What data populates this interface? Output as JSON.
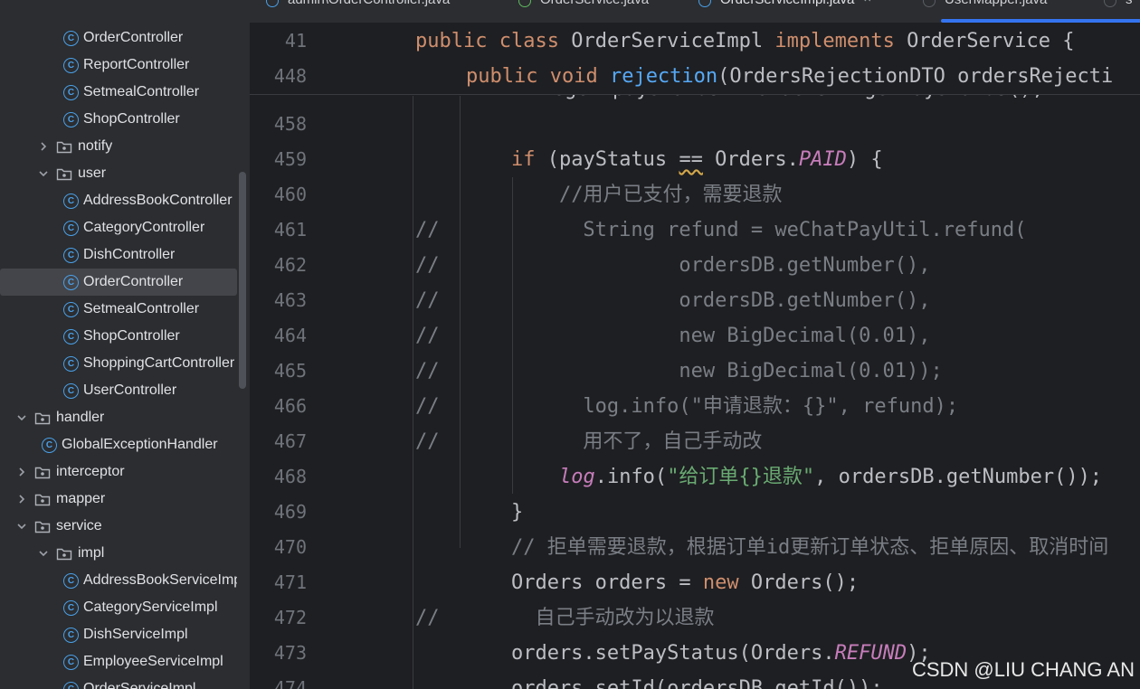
{
  "tree": {
    "items": [
      {
        "label": "OrderController",
        "kind": "class",
        "indent": 2
      },
      {
        "label": "ReportController",
        "kind": "class",
        "indent": 2
      },
      {
        "label": "SetmealController",
        "kind": "class",
        "indent": 2
      },
      {
        "label": "ShopController",
        "kind": "class",
        "indent": 2
      },
      {
        "label": "notify",
        "kind": "folder",
        "indent": 1,
        "expanded": false
      },
      {
        "label": "user",
        "kind": "folder",
        "indent": 1,
        "expanded": true
      },
      {
        "label": "AddressBookController",
        "kind": "class",
        "indent": 2
      },
      {
        "label": "CategoryController",
        "kind": "class",
        "indent": 2
      },
      {
        "label": "DishController",
        "kind": "class",
        "indent": 2
      },
      {
        "label": "OrderController",
        "kind": "class",
        "indent": 2,
        "selected": true
      },
      {
        "label": "SetmealController",
        "kind": "class",
        "indent": 2
      },
      {
        "label": "ShopController",
        "kind": "class",
        "indent": 2
      },
      {
        "label": "ShoppingCartController",
        "kind": "class",
        "indent": 2
      },
      {
        "label": "UserController",
        "kind": "class",
        "indent": 2
      },
      {
        "label": "handler",
        "kind": "folder",
        "indent": 0,
        "expanded": true
      },
      {
        "label": "GlobalExceptionHandler",
        "kind": "class",
        "indent": 1
      },
      {
        "label": "interceptor",
        "kind": "folder",
        "indent": 0,
        "expanded": false
      },
      {
        "label": "mapper",
        "kind": "folder",
        "indent": 0,
        "expanded": false
      },
      {
        "label": "service",
        "kind": "folder",
        "indent": 0,
        "expanded": true
      },
      {
        "label": "impl",
        "kind": "folder",
        "indent": 1,
        "expanded": true
      },
      {
        "label": "AddressBookServiceImpl",
        "kind": "class",
        "indent": 2
      },
      {
        "label": "CategoryServiceImpl",
        "kind": "class",
        "indent": 2
      },
      {
        "label": "DishServiceImpl",
        "kind": "class",
        "indent": 2
      },
      {
        "label": "EmployeeServiceImpl",
        "kind": "class",
        "indent": 2
      },
      {
        "label": "OrderServiceImpl",
        "kind": "class",
        "indent": 2
      }
    ]
  },
  "tabs": [
    {
      "label": "admin\\OrderController.java",
      "icon_color": "#4a9fe8"
    },
    {
      "label": "OrderService.java",
      "icon_color": "#5fb85f"
    },
    {
      "label": "OrderServiceImpl.java",
      "icon_color": "#4a9fe8",
      "active": true,
      "close": "×"
    },
    {
      "label": "UserMapper.java",
      "icon_color": "#5a5d63"
    },
    {
      "label": "s",
      "icon_color": "#5a5d63"
    }
  ],
  "sticky": {
    "lines": [
      {
        "num": "41",
        "indent": 0,
        "tokens": [
          [
            "kw",
            "public "
          ],
          [
            "kw",
            "class "
          ],
          [
            "",
            "OrderServiceImpl "
          ],
          [
            "kw",
            "implements "
          ],
          [
            "",
            "OrderService {"
          ]
        ]
      },
      {
        "num": "448",
        "indent": 1,
        "tokens": [
          [
            "kw",
            "public "
          ],
          [
            "kw",
            "void "
          ],
          [
            "fn",
            "rejection"
          ],
          [
            "",
            "(OrdersRejectionDTO ordersRejecti"
          ]
        ]
      }
    ]
  },
  "code": {
    "partial_line": "Integer payStatus = ordersDB.getPayStatus();",
    "lines": [
      {
        "num": "458",
        "comment": "",
        "tokens": []
      },
      {
        "num": "459",
        "comment": "",
        "tokens": [
          [
            "",
            "        "
          ],
          [
            "kw",
            "if "
          ],
          [
            "",
            "("
          ],
          [
            "squig-id",
            "payStatus"
          ],
          [
            "",
            " "
          ],
          [
            "squig",
            "=="
          ],
          [
            "",
            " Orders."
          ],
          [
            "const",
            "PAID"
          ],
          [
            "",
            ") {"
          ]
        ]
      },
      {
        "num": "460",
        "comment": "",
        "tokens": [
          [
            "",
            "            "
          ],
          [
            "cm",
            "//用户已支付，需要退款"
          ]
        ]
      },
      {
        "num": "461",
        "comment": "//",
        "tokens": [
          [
            "",
            "              String refund = weChatPayUtil.refund("
          ]
        ]
      },
      {
        "num": "462",
        "comment": "//",
        "tokens": [
          [
            "",
            "                      ordersDB.getNumber(),"
          ]
        ]
      },
      {
        "num": "463",
        "comment": "//",
        "tokens": [
          [
            "",
            "                      ordersDB.getNumber(),"
          ]
        ]
      },
      {
        "num": "464",
        "comment": "//",
        "tokens": [
          [
            "",
            "                      new BigDecimal(0.01),"
          ]
        ]
      },
      {
        "num": "465",
        "comment": "//",
        "tokens": [
          [
            "",
            "                      new BigDecimal(0.01));"
          ]
        ]
      },
      {
        "num": "466",
        "comment": "//",
        "tokens": [
          [
            "",
            "              log.info(\"申请退款：{}\", refund);"
          ]
        ]
      },
      {
        "num": "467",
        "comment": "//",
        "tokens": [
          [
            "",
            "              用不了，自己手动改"
          ]
        ]
      },
      {
        "num": "468",
        "comment": "",
        "tokens": [
          [
            "",
            "            "
          ],
          [
            "sfn",
            "log"
          ],
          [
            "",
            ".info("
          ],
          [
            "str",
            "\"给订单{}退款\""
          ],
          [
            "",
            ", ordersDB.getNumber());"
          ]
        ]
      },
      {
        "num": "469",
        "comment": "",
        "tokens": [
          [
            "",
            "        }"
          ]
        ]
      },
      {
        "num": "470",
        "comment": "",
        "tokens": [
          [
            "",
            "        "
          ],
          [
            "cm",
            "// 拒单需要退款，根据订单id更新订单状态、拒单原因、取消时间"
          ]
        ]
      },
      {
        "num": "471",
        "comment": "",
        "tokens": [
          [
            "",
            "        Orders orders = "
          ],
          [
            "kw",
            "new "
          ],
          [
            "",
            "Orders();"
          ]
        ]
      },
      {
        "num": "472",
        "comment": "//",
        "tokens": [
          [
            "",
            "          自己手动改为以退款"
          ]
        ]
      },
      {
        "num": "473",
        "comment": "",
        "tokens": [
          [
            "",
            "        orders.setPayStatus(Orders."
          ],
          [
            "const",
            "REFUND"
          ],
          [
            "",
            ");"
          ]
        ]
      },
      {
        "num": "474",
        "comment": "",
        "tokens": [
          [
            "",
            "        orders.setId(ordersDB.getId());"
          ]
        ]
      }
    ]
  },
  "watermark": "CSDN @LIU CHANG AN"
}
